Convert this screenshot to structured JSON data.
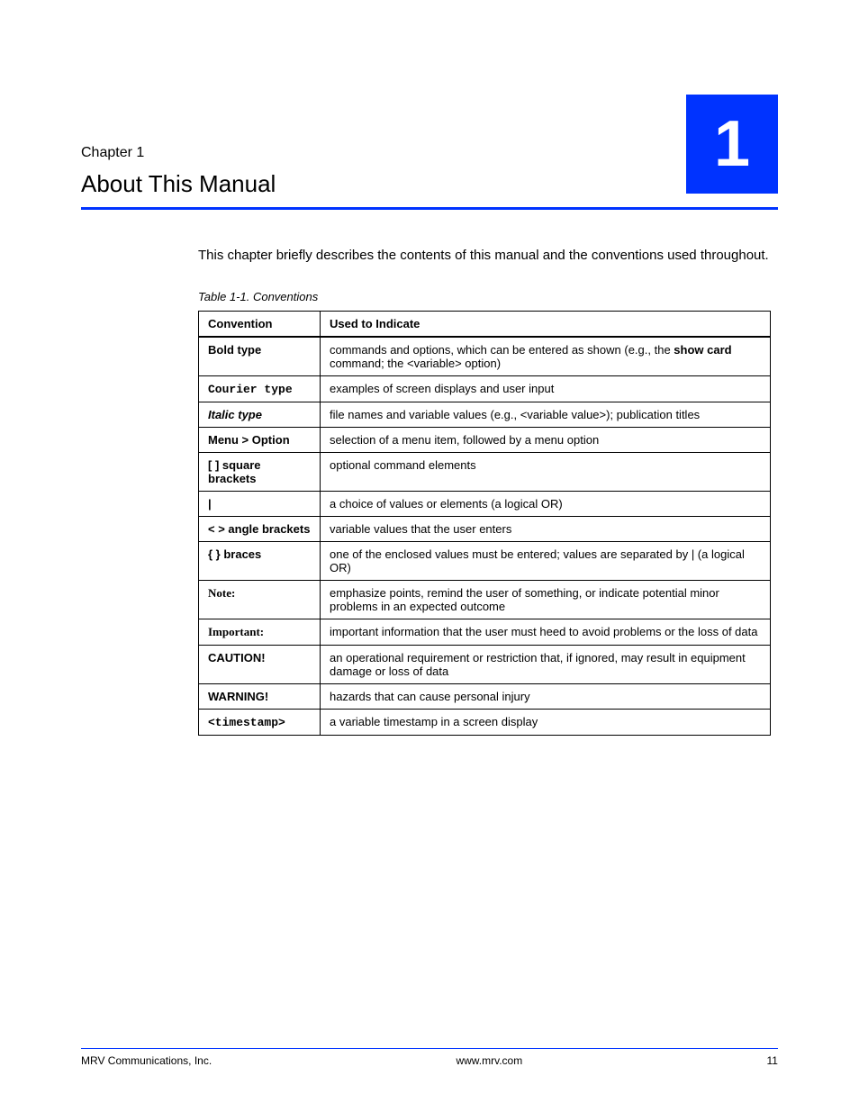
{
  "header": {
    "chapter_label": "Chapter 1",
    "chapter_title": "About This Manual",
    "chapter_number": "1"
  },
  "intro": "This chapter briefly describes the contents of this manual and the conventions used throughout.",
  "table": {
    "caption": "Table 1-1. Conventions",
    "col1": "Convention",
    "col2": "Used to Indicate",
    "rows": [
      {
        "conv": "Bold type",
        "desc_pre": "commands and options, which can be entered as shown (e.g., the ",
        "desc_cmd": "show card",
        "desc_post": " command; the <variable> option)"
      },
      {
        "conv": "Courier type",
        "desc": "examples of screen displays and user input"
      },
      {
        "conv": "Italic type",
        "desc": "file names and variable values (e.g., <variable value>); publication titles"
      },
      {
        "conv": "Menu > Option",
        "desc": "selection of a menu item, followed by a menu option"
      },
      {
        "conv": "[ ]   square brackets",
        "desc": "optional command elements"
      },
      {
        "conv": "|",
        "desc": "a choice of values or elements (a logical OR)"
      },
      {
        "conv": "< >  angle brackets",
        "desc": "variable values that the user enters"
      },
      {
        "conv": "{ }   braces",
        "desc": "one of the enclosed values must be entered; values are separated by |  (a logical OR)"
      },
      {
        "conv": "Note:",
        "desc": "emphasize points, remind the user of something, or indicate potential minor problems in an expected outcome"
      },
      {
        "conv": "Important:",
        "desc": "important information that the user must heed to avoid problems or the loss of data"
      },
      {
        "conv": "CAUTION!",
        "desc": "an operational requirement or restriction that, if ignored, may result in equipment damage or loss of data"
      },
      {
        "conv": "WARNING!",
        "desc": "hazards that can cause personal injury"
      },
      {
        "conv": "<timestamp>",
        "desc": "a variable timestamp in a screen display"
      }
    ]
  },
  "footer": {
    "left": "MRV Communications, Inc.",
    "center": "www.mrv.com",
    "right": "11"
  }
}
